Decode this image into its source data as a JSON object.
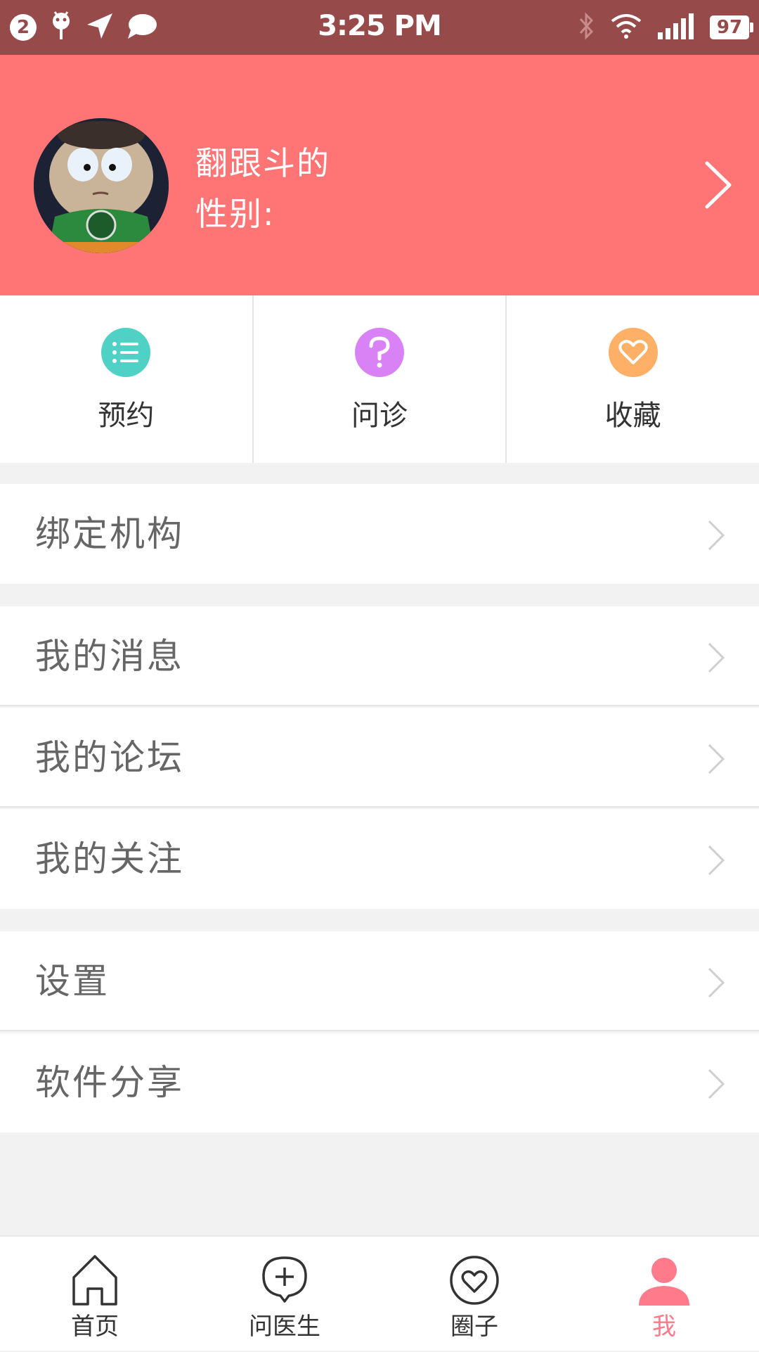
{
  "status_bar": {
    "notification_count": "2",
    "time": "3:25 PM",
    "battery": "97",
    "icons": [
      "notification-badge-icon",
      "android-debug-icon",
      "location-arrow-icon",
      "chat-bubble-icon",
      "bluetooth-icon",
      "wifi-icon",
      "signal-icon",
      "battery-icon"
    ]
  },
  "profile": {
    "name": "翻跟斗的",
    "gender_label": "性别:"
  },
  "quick_actions": [
    {
      "label": "预约",
      "icon": "list-icon",
      "color": "#4fd1c5"
    },
    {
      "label": "问诊",
      "icon": "question-icon",
      "color": "#d982f5"
    },
    {
      "label": "收藏",
      "icon": "heart-icon",
      "color": "#ffb067"
    }
  ],
  "menu": {
    "bind_org": "绑定机构",
    "my_messages": "我的消息",
    "my_forum": "我的论坛",
    "my_follows": "我的关注",
    "settings": "设置",
    "share_app": "软件分享"
  },
  "tabs": [
    {
      "label": "首页",
      "icon": "home-icon"
    },
    {
      "label": "问医生",
      "icon": "ask-doctor-icon"
    },
    {
      "label": "圈子",
      "icon": "circle-heart-icon"
    },
    {
      "label": "我",
      "icon": "profile-icon",
      "active": true
    }
  ],
  "colors": {
    "status_bar": "#974a4a",
    "header": "#ff7575",
    "accent": "#ff7a8a",
    "background": "#f2f2f2"
  }
}
